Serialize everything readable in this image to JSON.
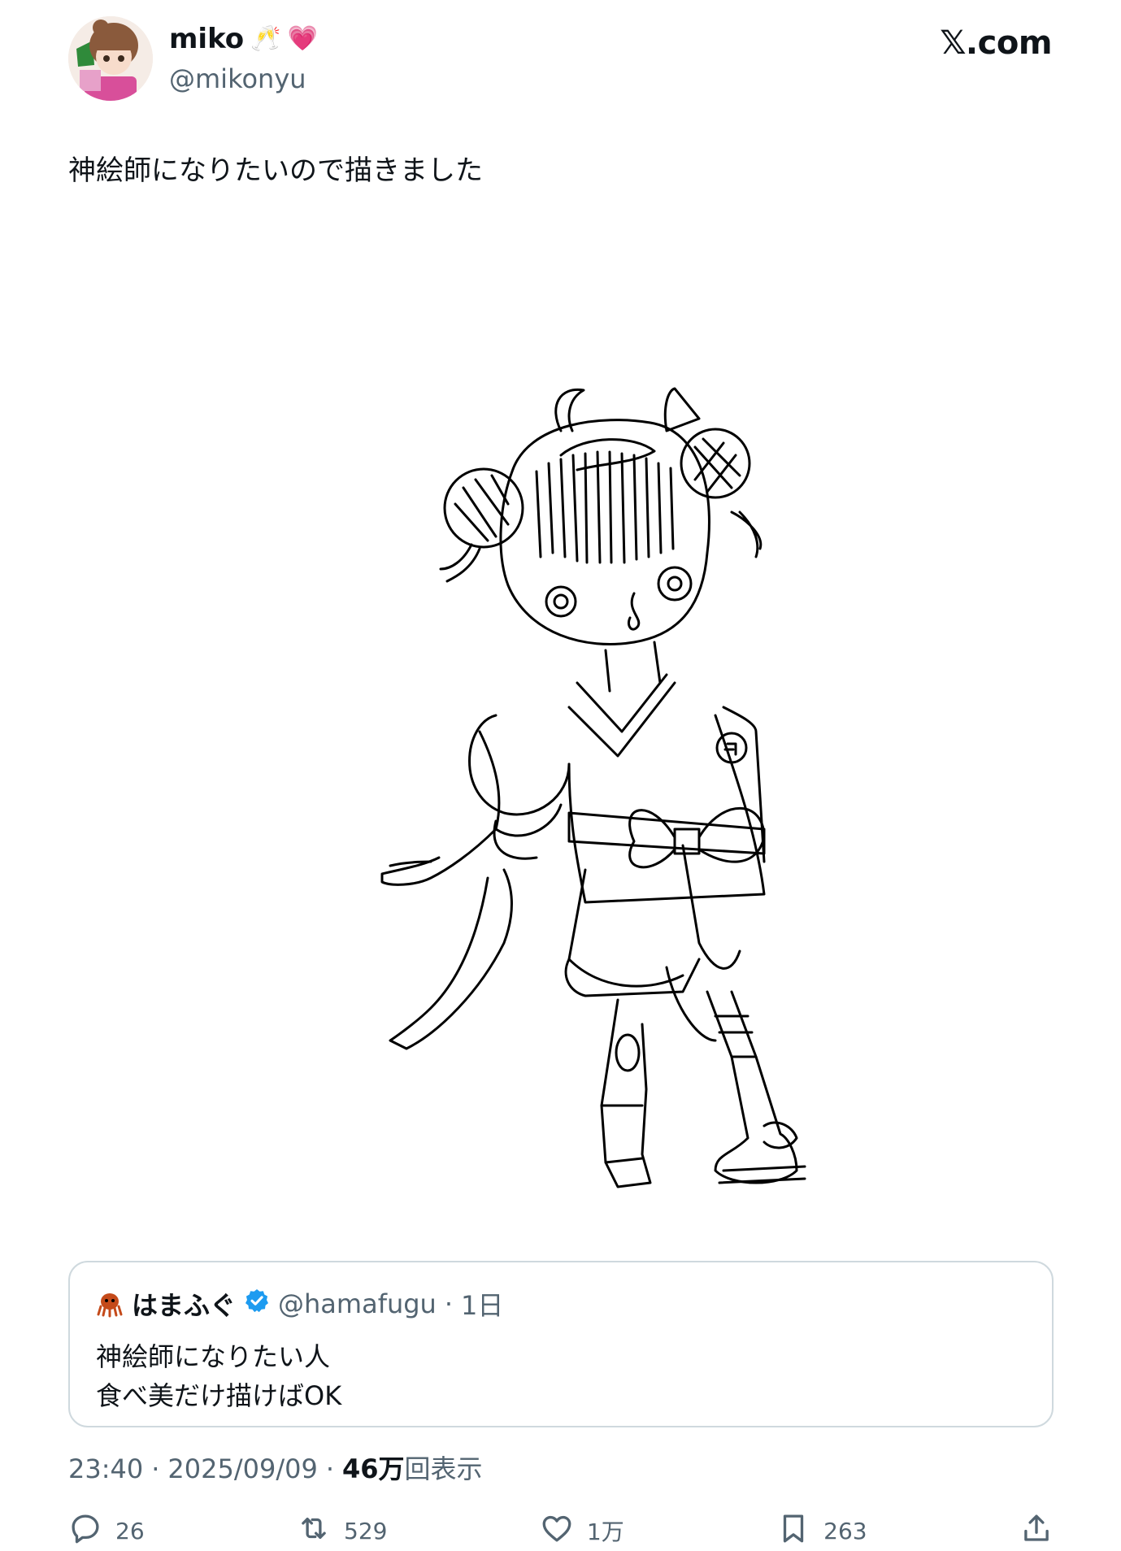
{
  "author": {
    "display_name": "miko",
    "emojis": [
      "🥂",
      "💗"
    ],
    "handle": "@mikonyu"
  },
  "brand": "𝕏.com",
  "tweet": {
    "text": "神絵師になりたいので描きました"
  },
  "quote": {
    "avatar_emoji": "🐙",
    "display_name": "はまふぐ",
    "handle": "@hamafugu",
    "separator": "·",
    "time": "1日",
    "lines": [
      "神絵師になりたい人",
      "食べ美だけ描けばOK"
    ]
  },
  "meta": {
    "time": "23:40",
    "separator": "·",
    "date": "2025/09/09",
    "views_count": "46万",
    "views_label": "回表示"
  },
  "actions": {
    "replies": "26",
    "reposts": "529",
    "likes": "1万",
    "bookmarks": "263"
  },
  "colors": {
    "text": "#0f1419",
    "secondary": "#536471",
    "border": "#cfd9de",
    "verified": "#1d9bf0"
  }
}
